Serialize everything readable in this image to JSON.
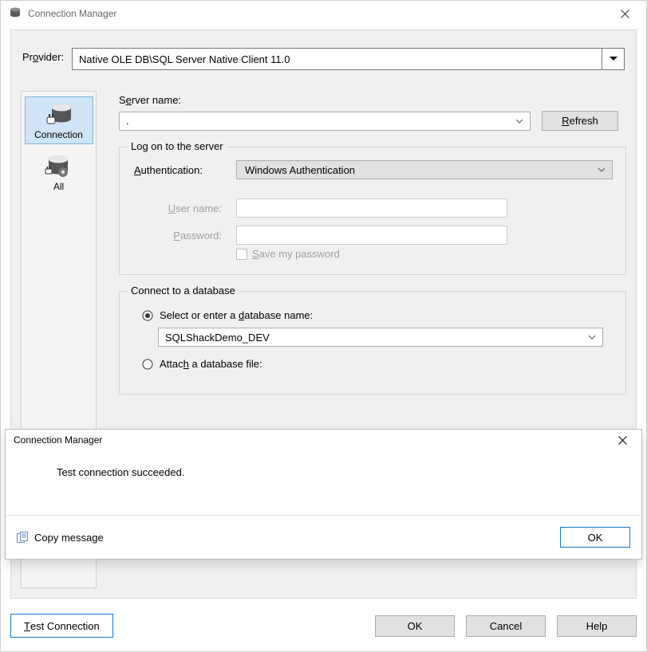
{
  "window": {
    "title": "Connection Manager"
  },
  "provider": {
    "label_pre": "Pr",
    "label_u": "o",
    "label_post": "vider:",
    "value": "Native OLE DB\\SQL Server Native Client 11.0"
  },
  "icons": {
    "connection": "Connection",
    "all": "All"
  },
  "server": {
    "label_pre": "S",
    "label_u": "e",
    "label_post": "rver name:",
    "value": ".",
    "refresh_pre": "",
    "refresh_u": "R",
    "refresh_post": "efresh"
  },
  "logon": {
    "legend": "Log on to the server",
    "auth_label_u": "A",
    "auth_label_post": "uthentication:",
    "auth_value": "Windows Authentication",
    "user_label_u": "U",
    "user_label_post": "ser name:",
    "pass_label_u": "P",
    "pass_label_post": "assword:",
    "save_pre": "",
    "save_u": "S",
    "save_post": "ave my password"
  },
  "db": {
    "legend": "Connect to a database",
    "radio1_pre": "Select or enter a ",
    "radio1_u": "d",
    "radio1_post": "atabase name:",
    "db_value": "SQLShackDemo_DEV",
    "radio2_pre": "Attac",
    "radio2_u": "h",
    "radio2_post": " a database file:"
  },
  "buttons": {
    "test_u": "T",
    "test_post": "est Connection",
    "ok": "OK",
    "cancel": "Cancel",
    "help": "Help"
  },
  "dialog": {
    "title": "Connection Manager",
    "message": "Test connection succeeded.",
    "copy": "Copy message",
    "ok": "OK"
  }
}
